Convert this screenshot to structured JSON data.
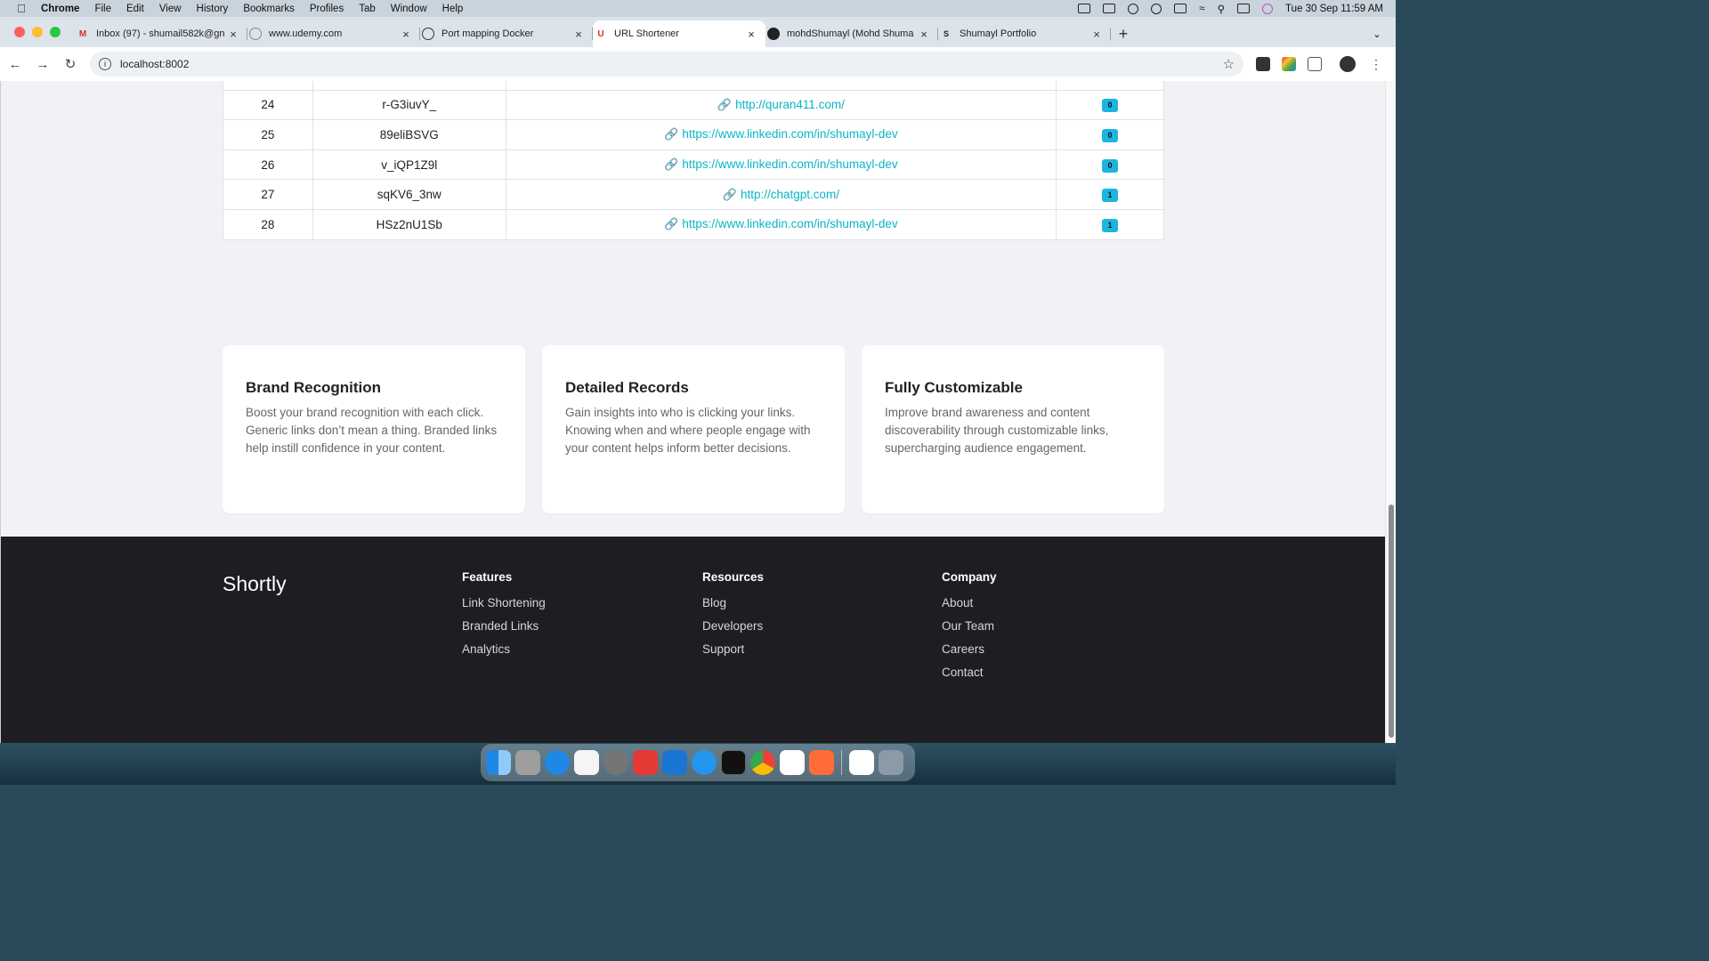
{
  "menubar": {
    "apple": "",
    "items": [
      "Chrome",
      "File",
      "Edit",
      "View",
      "History",
      "Bookmarks",
      "Profiles",
      "Tab",
      "Window",
      "Help"
    ],
    "clock": "Tue 30 Sep  11:59 AM",
    "status_icons": [
      "docker-icon",
      "display-icon",
      "play-icon",
      "headphones-icon",
      "battery-icon",
      "wifi-icon",
      "spotlight-icon",
      "control-center-icon",
      "siri-icon"
    ]
  },
  "tabs": [
    {
      "label": "Inbox (97) - shumail582k@gn",
      "icon": "gmail-icon",
      "active": false
    },
    {
      "label": "www.udemy.com",
      "icon": "globe-icon",
      "active": false
    },
    {
      "label": "Port mapping Docker",
      "icon": "openai-icon",
      "active": false
    },
    {
      "label": "URL Shortener",
      "icon": "magnet-icon",
      "active": true
    },
    {
      "label": "mohdShumayl (Mohd Shuma",
      "icon": "github-icon",
      "active": false
    },
    {
      "label": "Shumayl Portfolio",
      "icon": "portfolio-icon",
      "active": false
    }
  ],
  "toolbar": {
    "url": "localhost:8002",
    "icons": [
      "back-icon",
      "forward-icon",
      "reload-icon",
      "star-icon"
    ]
  },
  "table": {
    "rows": [
      {
        "id": "24",
        "short": "r-G3iuvY_",
        "url": "http://quran411.com/",
        "clicks": "0"
      },
      {
        "id": "25",
        "short": "89eliBSVG",
        "url": "https://www.linkedin.com/in/shumayl-dev",
        "clicks": "0"
      },
      {
        "id": "26",
        "short": "v_iQP1Z9l",
        "url": "https://www.linkedin.com/in/shumayl-dev",
        "clicks": "0"
      },
      {
        "id": "27",
        "short": "sqKV6_3nw",
        "url": "http://chatgpt.com/",
        "clicks": "1"
      },
      {
        "id": "28",
        "short": "HSz2nU1Sb",
        "url": "https://www.linkedin.com/in/shumayl-dev",
        "clicks": "1"
      }
    ]
  },
  "features": [
    {
      "title": "Brand Recognition",
      "text": "Boost your brand recognition with each click. Generic links don’t mean a thing. Branded links help instill confidence in your content."
    },
    {
      "title": "Detailed Records",
      "text": "Gain insights into who is clicking your links. Knowing when and where people engage with your content helps inform better decisions."
    },
    {
      "title": "Fully Customizable",
      "text": "Improve brand awareness and content discoverability through customizable links, supercharging audience engagement."
    }
  ],
  "footer": {
    "brand": "Shortly",
    "columns": [
      {
        "heading": "Features",
        "links": [
          "Link Shortening",
          "Branded Links",
          "Analytics"
        ]
      },
      {
        "heading": "Resources",
        "links": [
          "Blog",
          "Developers",
          "Support"
        ]
      },
      {
        "heading": "Company",
        "links": [
          "About",
          "Our Team",
          "Careers",
          "Contact"
        ]
      }
    ]
  },
  "colors": {
    "link": "#0bb5c6",
    "badge": "#1cb5e0",
    "footer_bg": "#1e1e22",
    "page_bg": "#f1f2f6"
  },
  "dock": [
    "finder-icon",
    "launchpad-icon",
    "safari-icon",
    "textedit-icon",
    "settings-icon",
    "anydesk-icon",
    "xcode-icon",
    "docker-icon",
    "terminal-icon",
    "chrome-icon",
    "vscode-icon",
    "postman-icon",
    "magnet-icon",
    "trash-icon"
  ]
}
